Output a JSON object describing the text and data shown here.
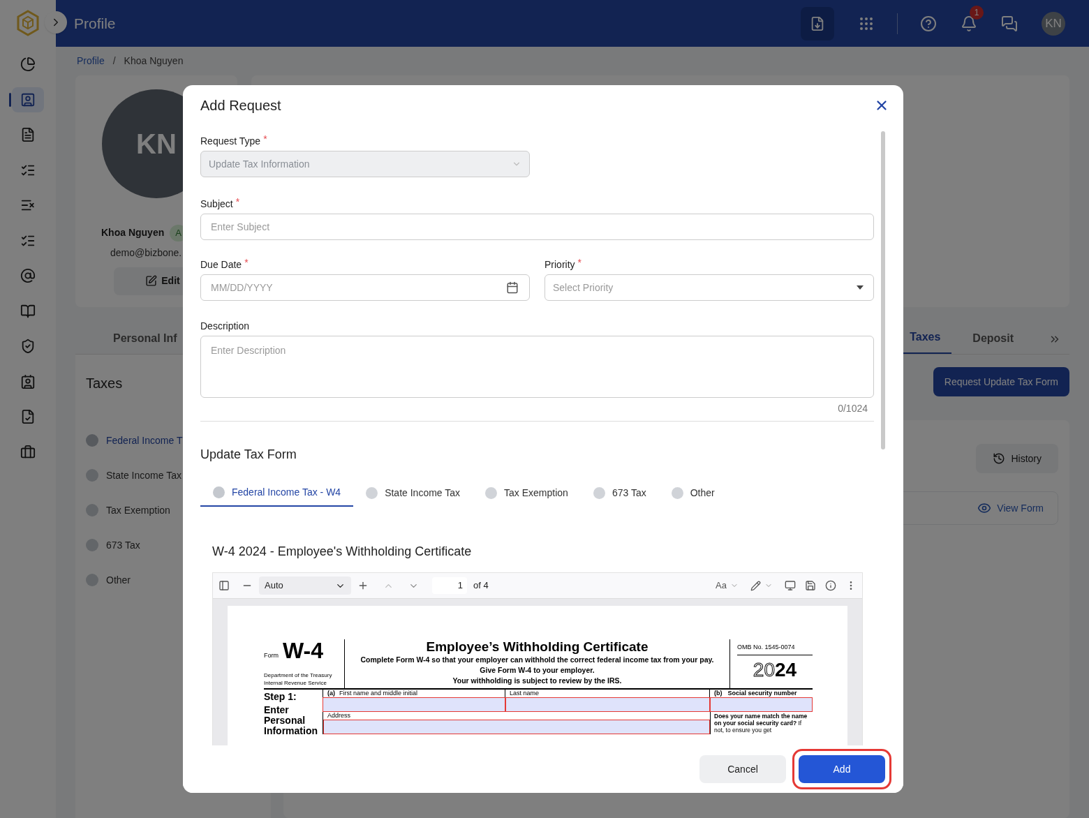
{
  "header": {
    "title": "Profile",
    "notifications": "1",
    "avatar": "KN"
  },
  "sidebar": {
    "items": [
      {
        "selected": false
      },
      {
        "selected": true
      },
      {
        "selected": false
      },
      {
        "selected": false
      },
      {
        "selected": false
      },
      {
        "selected": false
      },
      {
        "selected": false
      },
      {
        "selected": false
      },
      {
        "selected": false
      },
      {
        "selected": false
      },
      {
        "selected": false
      },
      {
        "selected": false
      }
    ]
  },
  "breadcrumb": [
    {
      "label": "Profile",
      "kind": "link"
    },
    {
      "label": "/",
      "kind": "separator"
    },
    {
      "label": "Khoa Nguyen",
      "kind": "current"
    }
  ],
  "profile": {
    "initials": "KN",
    "name": "Khoa Nguyen",
    "badge": "A",
    "email": "demo@bizbone.",
    "edit": "Edit"
  },
  "tabs": [
    {
      "label": "Personal Inf",
      "selected": false
    },
    {
      "label": "Taxes",
      "selected": true
    },
    {
      "label": "Deposit",
      "selected": false
    }
  ],
  "taxes_panel": {
    "title": "Taxes",
    "items": [
      {
        "label": "Federal Income T",
        "selected": true
      },
      {
        "label": "State Income Tax",
        "selected": false
      },
      {
        "label": "Tax Exemption",
        "selected": false
      },
      {
        "label": "673 Tax",
        "selected": false
      },
      {
        "label": "Other",
        "selected": false
      }
    ]
  },
  "request_button": "Request Update Tax Form",
  "history_button": "History",
  "view_form": "View Form",
  "modal": {
    "title": "Add Request",
    "request_type": {
      "label": "Request Type",
      "required_mark": "*",
      "value": "Update Tax Information",
      "disabled": true
    },
    "subject": {
      "label": "Subject",
      "required_mark": "*",
      "placeholder": "Enter Subject"
    },
    "due_date": {
      "label": "Due Date",
      "required_mark": "*",
      "placeholder": "MM/DD/YYYY"
    },
    "priority": {
      "label": "Priority",
      "required_mark": "*",
      "placeholder": "Select Priority"
    },
    "description": {
      "label": "Description",
      "placeholder": "Enter Description",
      "counter": "0/1024"
    },
    "section_title": "Update Tax Form",
    "form_tabs": [
      {
        "label": "Federal Income Tax - W4",
        "selected": true
      },
      {
        "label": "State Income Tax",
        "selected": false
      },
      {
        "label": "Tax Exemption",
        "selected": false
      },
      {
        "label": "673 Tax",
        "selected": false
      },
      {
        "label": "Other",
        "selected": false
      }
    ],
    "document_title": "W-4 2024 - Employee's Withholding Certificate",
    "viewer": {
      "zoom": "Auto",
      "page": "1",
      "page_count": "of 4",
      "text_tool": "Aa"
    },
    "document": {
      "form_label": "Form",
      "form_number": "W-4",
      "dept": "Department of the Treasury",
      "irs": "Internal Revenue Service",
      "title": "Employee’s Withholding Certificate",
      "lines": [
        "Complete Form W-4 so that your employer can withhold the correct federal income tax from your pay.",
        "Give Form W-4 to your employer.",
        "Your withholding is subject to review by the IRS."
      ],
      "omb": "OMB No. 1545-0074",
      "year_outline": "20",
      "year_bold": "24",
      "step": "Step 1:",
      "step_title": "Enter Personal Information",
      "field_a_mark": "(a)",
      "field_a": "First name and middle initial",
      "field_last": "Last name",
      "field_b_mark": "(b)",
      "field_b": "Social security number",
      "field_address": "Address",
      "note": "**Does your name match the name on your social security card?** If not, to ensure you get"
    },
    "buttons": [
      {
        "label": "Cancel",
        "kind": "secondary"
      },
      {
        "label": "Add",
        "kind": "primary",
        "highlighted": true
      }
    ]
  }
}
